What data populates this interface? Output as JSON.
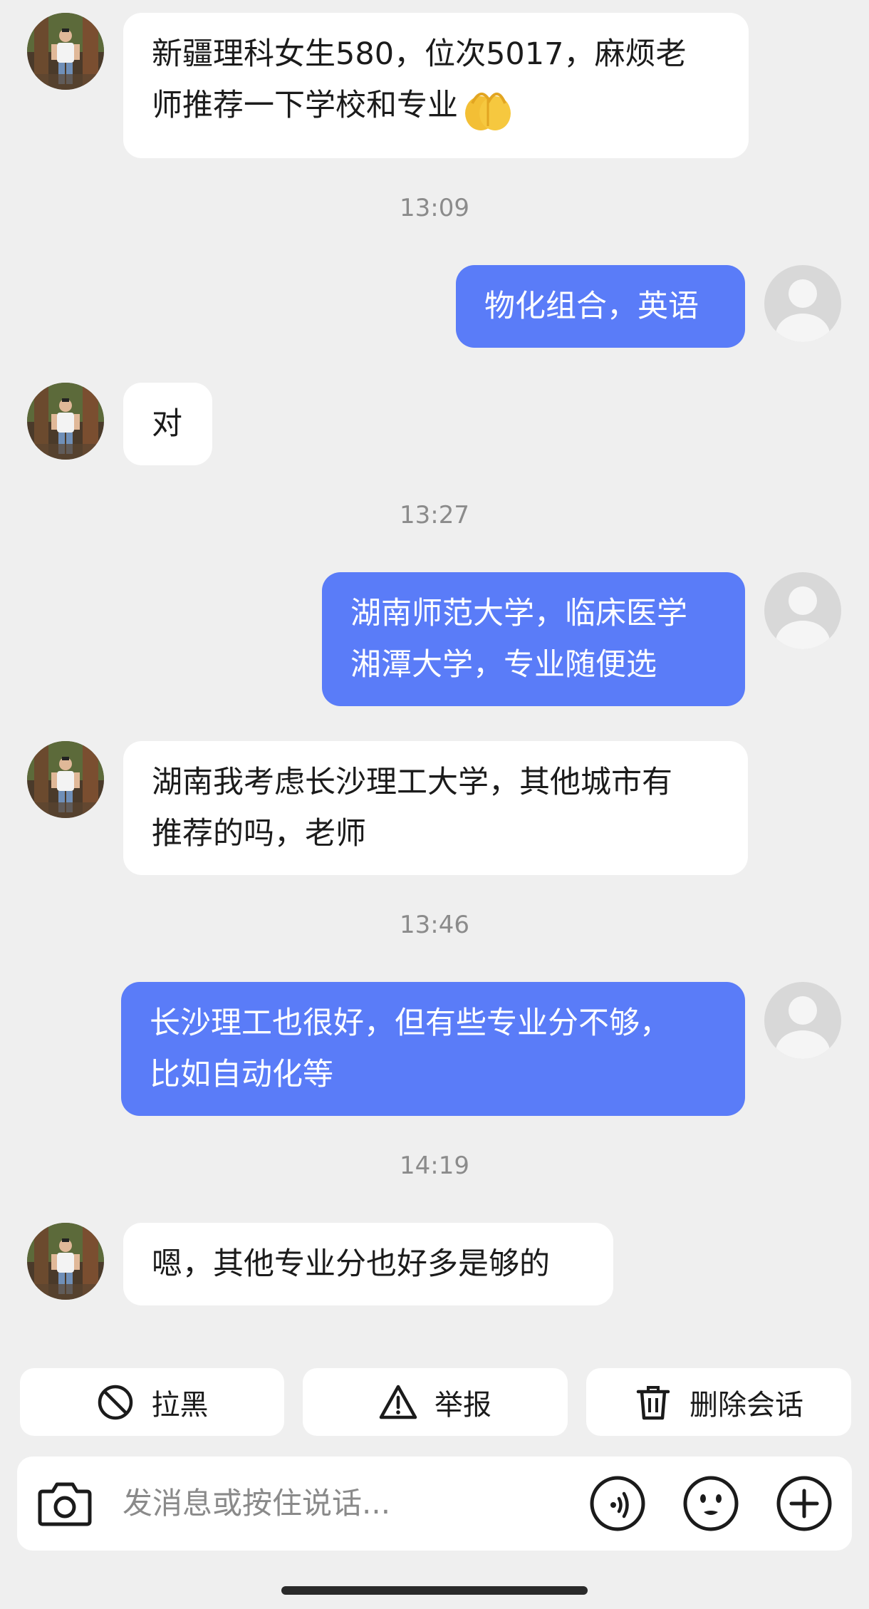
{
  "messages": {
    "m1": {
      "line1": "新疆理科女生580，位次5017，麻烦老",
      "line2": "师推荐一下学校和专业"
    },
    "t1": "13:09",
    "m2": "物化组合，英语",
    "m3": "对",
    "t2": "13:27",
    "m4": {
      "line1": "湖南师范大学，临床医学",
      "line2": "湘潭大学，专业随便选"
    },
    "m5": {
      "line1": "湖南我考虑长沙理工大学，其他城市有",
      "line2": "推荐的吗，老师"
    },
    "t3": "13:46",
    "m6": {
      "line1": "长沙理工也很好，但有些专业分不够，",
      "line2": "比如自动化等"
    },
    "t4": "14:19",
    "m7": "嗯，其他专业分也好多是够的"
  },
  "actions": {
    "block_label": "拉黑",
    "report_label": "举报",
    "delete_label": "删除会话"
  },
  "composer": {
    "placeholder": "发消息或按住说话..."
  },
  "icons": {
    "peer_avatar": "person-photo-avatar",
    "self_avatar": "default-user-avatar",
    "emoji": "pray-hands-emoji",
    "block": "block-icon",
    "report": "warning-icon",
    "delete": "trash-icon",
    "camera": "camera-icon",
    "voice": "voice-wave-icon",
    "sticker": "smiley-icon",
    "more": "plus-icon"
  },
  "colors": {
    "self_bubble": "#5a7cf8",
    "peer_bubble": "#ffffff",
    "background": "#efefef"
  }
}
